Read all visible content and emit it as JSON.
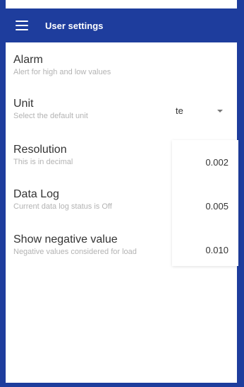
{
  "header": {
    "title": "User settings",
    "menu_icon": "hamburger-menu-icon"
  },
  "settings": [
    {
      "title": "Alarm",
      "subtitle": "Alert for high and low values"
    },
    {
      "title": "Unit",
      "subtitle": "Select the default unit",
      "value": "te"
    },
    {
      "title": "Resolution",
      "subtitle": "This is in decimal"
    },
    {
      "title": "Data Log",
      "subtitle": "Current data log status is Off"
    },
    {
      "title": "Show negative value",
      "subtitle": "Negative values considered for load"
    }
  ],
  "resolution_options": [
    "0.002",
    "0.005",
    "0.010"
  ],
  "colors": {
    "primary": "#1e3d9d",
    "title_text": "#333333",
    "subtitle_text": "#b3b3b3"
  }
}
